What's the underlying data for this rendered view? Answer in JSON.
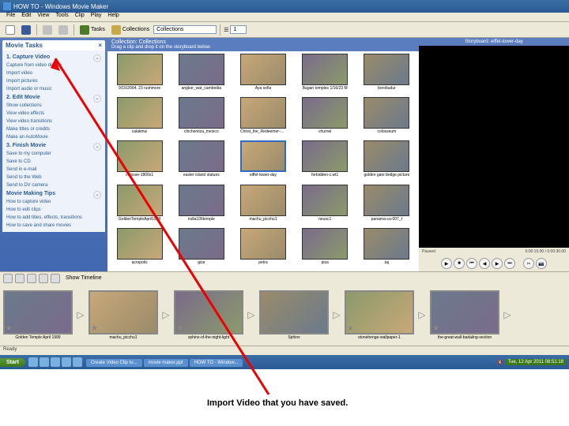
{
  "titlebar": {
    "title": "HOW TO - Windows Movie Maker"
  },
  "menu": [
    "File",
    "Edit",
    "View",
    "Tools",
    "Clip",
    "Play",
    "Help"
  ],
  "toolbar": {
    "tasks": "Tasks",
    "collections": "Collections",
    "coll_dd": "Collections",
    "zoom": "1"
  },
  "sidebar": {
    "header": "Movie Tasks",
    "sections": [
      {
        "title": "1. Capture Video",
        "items": [
          "Capture from video device",
          "Import video",
          "Import pictures",
          "Import audio or music"
        ]
      },
      {
        "title": "2. Edit Movie",
        "items": [
          "Show collections",
          "View video effects",
          "View video transitions",
          "Make titles or credits",
          "Make an AutoMovie"
        ]
      },
      {
        "title": "3. Finish Movie",
        "items": [
          "Save to my computer",
          "Save to CD",
          "Send in e-mail",
          "Send to the Web",
          "Send to DV camera"
        ]
      },
      {
        "title": "Movie Making Tips",
        "items": [
          "How to capture video",
          "How to edit clips",
          "How to add titles, effects, transitions",
          "How to save and share movies"
        ]
      }
    ]
  },
  "collection": {
    "title": "Collection: Collections",
    "sub": "Drag a clip and drop it on the storyboard below.",
    "items": [
      "9/15/2004, 23 rushmore",
      "angkor_wat_cambodia",
      "Aya sofia",
      "Bagan temples 1/16/23 M",
      "borobudur",
      "calakmul",
      "chichenitza_mexico",
      "Christ_the_Redeemer-best",
      "churnel",
      "colosseum",
      "colosse-1800x1",
      "easter island statues",
      "eiffel-tower-day",
      "forbidden-c.wt1",
      "golden gate bridge picture",
      "GoldenTempleApril1999",
      "india106temple",
      "machu_picchu1",
      "neusc1",
      "panama-ca-007_t",
      "acropolis",
      "giza",
      "petra",
      "pisa",
      "taj"
    ],
    "selected_index": 12
  },
  "preview": {
    "title": "Storyboard: eiffel-tower-day",
    "status_left": "Paused",
    "status_right": "0:00:15.00 / 0:00:30.00"
  },
  "timeline_tools": {
    "show_timeline": "Show Timeline"
  },
  "storyboard": {
    "items": [
      "Golden Temple April 1999",
      "machu_picchu1",
      "sphinx-of-the-night-light",
      "Sphinx",
      "stonehenge-wallpaper-1",
      "the-great-wall-badaling-section"
    ]
  },
  "statusbar": {
    "text": "Ready"
  },
  "taskbar": {
    "start": "Start",
    "tasks": [
      "Create Video Clip tu...",
      "movie maker.ppt",
      "HOW TO - Window..."
    ],
    "clock": "Tue, 12 Apr 2011  08:51:18"
  },
  "caption": "Import Video that you have saved."
}
